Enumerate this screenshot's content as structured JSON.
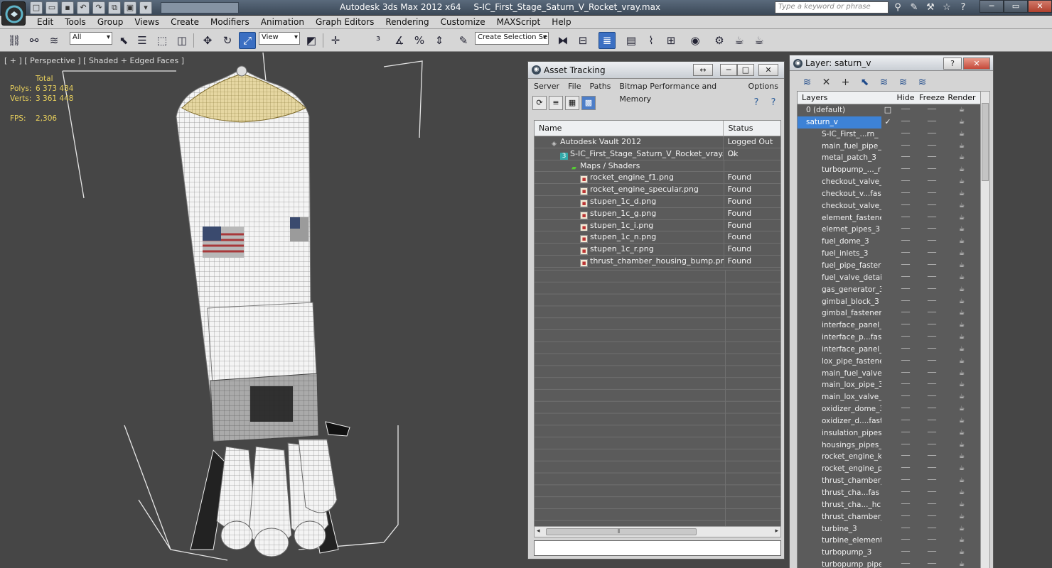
{
  "app": {
    "title": "Autodesk 3ds Max  2012 x64",
    "file": "S-IC_First_Stage_Saturn_V_Rocket_vray.max",
    "search_placeholder": "Type a keyword or phrase"
  },
  "menu": [
    "Edit",
    "Tools",
    "Group",
    "Views",
    "Create",
    "Modifiers",
    "Animation",
    "Graph Editors",
    "Rendering",
    "Customize",
    "MAXScript",
    "Help"
  ],
  "toolbar": {
    "selection_filter": "All",
    "ref_coord": "View",
    "named_selection": "Create Selection Se"
  },
  "viewport": {
    "label": "[ + ] [ Perspective ] [ Shaded + Edged Faces ]",
    "stats_header": "Total",
    "polys_label": "Polys:",
    "polys_value": "6 373 484",
    "verts_label": "Verts:",
    "verts_value": "3 361 448",
    "fps_label": "FPS:",
    "fps_value": "2,306"
  },
  "asset_tracking": {
    "title": "Asset Tracking",
    "menu": [
      "Server",
      "File",
      "Paths",
      "Bitmap Performance and Memory",
      "Options"
    ],
    "col_name": "Name",
    "col_status": "Status",
    "rows": [
      {
        "name": "Autodesk Vault 2012",
        "status": "Logged Out ..."
      },
      {
        "name": "S-IC_First_Stage_Saturn_V_Rocket_vray.max",
        "status": "Ok"
      },
      {
        "name": "Maps / Shaders",
        "status": ""
      },
      {
        "name": "rocket_engine_f1.png",
        "status": "Found"
      },
      {
        "name": "rocket_engine_specular.png",
        "status": "Found"
      },
      {
        "name": "stupen_1c_d.png",
        "status": "Found"
      },
      {
        "name": "stupen_1c_g.png",
        "status": "Found"
      },
      {
        "name": "stupen_1c_i.png",
        "status": "Found"
      },
      {
        "name": "stupen_1c_n.png",
        "status": "Found"
      },
      {
        "name": "stupen_1c_r.png",
        "status": "Found"
      },
      {
        "name": "thrust_chamber_housing_bump.png",
        "status": "Found"
      }
    ]
  },
  "layers": {
    "title": "Layer: saturn_v",
    "col_layers": "Layers",
    "col_hide": "Hide",
    "col_freeze": "Freeze",
    "col_render": "Render",
    "items": [
      "0 (default)",
      "saturn_v",
      "S-IC_First_...rn_",
      "main_fuel_pipe_",
      "metal_patch_3",
      "turbopump_..._r",
      "checkout_valve_",
      "checkout_v...fas",
      "checkout_valve_",
      "element_fastene",
      "elemet_pipes_3",
      "fuel_dome_3",
      "fuel_inlets_3",
      "fuel_pipe_faster",
      "fuel_valve_detai",
      "gas_generator_3",
      "gimbal_block_3",
      "gimbal_fasteners",
      "interface_panel_",
      "interface_p...fas",
      "interface_panel_",
      "lox_pipe_fastene",
      "main_fuel_valve_",
      "main_lox_pipe_3",
      "main_lox_valve_",
      "oxidizer_dome_3",
      "oxidizer_d....fast",
      "insulation_pipes_",
      "housings_pipes_",
      "rocket_engine_k",
      "rocket_engine_p",
      "thrust_chamber_",
      "thrust_cha...fas",
      "thrust_cha..._hc",
      "thrust_chamber_",
      "turbine_3",
      "turbine_element_",
      "turbopump_3",
      "turbopump_pipes"
    ]
  }
}
